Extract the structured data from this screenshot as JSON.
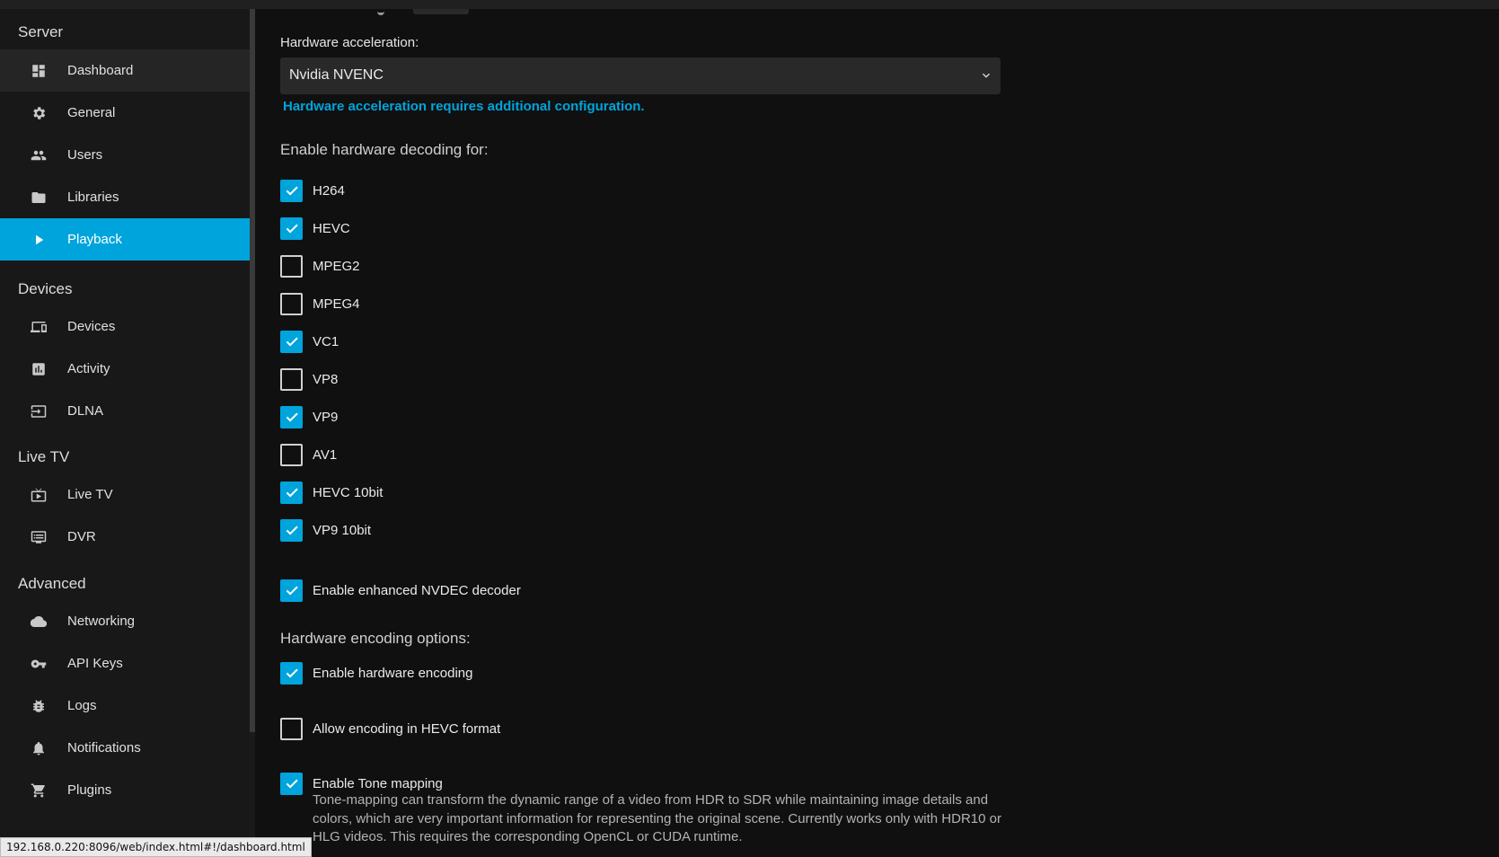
{
  "sidebar": {
    "sections": [
      {
        "title": "Server",
        "items": [
          {
            "label": "Dashboard",
            "icon": "dashboard-icon"
          },
          {
            "label": "General",
            "icon": "gear-icon"
          },
          {
            "label": "Users",
            "icon": "people-icon"
          },
          {
            "label": "Libraries",
            "icon": "folder-icon"
          },
          {
            "label": "Playback",
            "icon": "play-icon",
            "active": true
          }
        ]
      },
      {
        "title": "Devices",
        "items": [
          {
            "label": "Devices",
            "icon": "devices-icon"
          },
          {
            "label": "Activity",
            "icon": "chart-icon"
          },
          {
            "label": "DLNA",
            "icon": "input-icon"
          }
        ]
      },
      {
        "title": "Live TV",
        "items": [
          {
            "label": "Live TV",
            "icon": "tv-icon"
          },
          {
            "label": "DVR",
            "icon": "dvr-icon"
          }
        ]
      },
      {
        "title": "Advanced",
        "items": [
          {
            "label": "Networking",
            "icon": "cloud-icon"
          },
          {
            "label": "API Keys",
            "icon": "key-icon"
          },
          {
            "label": "Logs",
            "icon": "bug-icon"
          },
          {
            "label": "Notifications",
            "icon": "bell-icon"
          },
          {
            "label": "Plugins",
            "icon": "cart-icon"
          }
        ]
      }
    ]
  },
  "main": {
    "hw_accel_label": "Hardware acceleration:",
    "hw_accel_value": "Nvidia NVENC",
    "hw_config_link": "Hardware acceleration requires additional configuration.",
    "decoding_title": "Enable hardware decoding for:",
    "decoding_codecs": [
      {
        "label": "H264",
        "checked": true
      },
      {
        "label": "HEVC",
        "checked": true
      },
      {
        "label": "MPEG2",
        "checked": false
      },
      {
        "label": "MPEG4",
        "checked": false
      },
      {
        "label": "VC1",
        "checked": true
      },
      {
        "label": "VP8",
        "checked": false
      },
      {
        "label": "VP9",
        "checked": true
      },
      {
        "label": "AV1",
        "checked": false
      },
      {
        "label": "HEVC 10bit",
        "checked": true
      },
      {
        "label": "VP9 10bit",
        "checked": true
      }
    ],
    "nvdec_label": "Enable enhanced NVDEC decoder",
    "nvdec_checked": true,
    "encoding_title": "Hardware encoding options:",
    "hw_encoding_label": "Enable hardware encoding",
    "hw_encoding_checked": true,
    "hevc_encoding_label": "Allow encoding in HEVC format",
    "hevc_encoding_checked": false,
    "tonemap_label": "Enable Tone mapping",
    "tonemap_checked": true,
    "tonemap_description": "Tone-mapping can transform the dynamic range of a video from HDR to SDR while maintaining image details and colors, which are very important information for representing the original scene. Currently works only with HDR10 or HLG videos. This requires the corresponding OpenCL or CUDA runtime."
  },
  "status_bar": {
    "url": "192.168.0.220:8096/web/index.html#!/dashboard.html"
  },
  "colors": {
    "accent": "#00a4dc",
    "sidebar_bg": "#181818",
    "page_bg": "#101010"
  }
}
